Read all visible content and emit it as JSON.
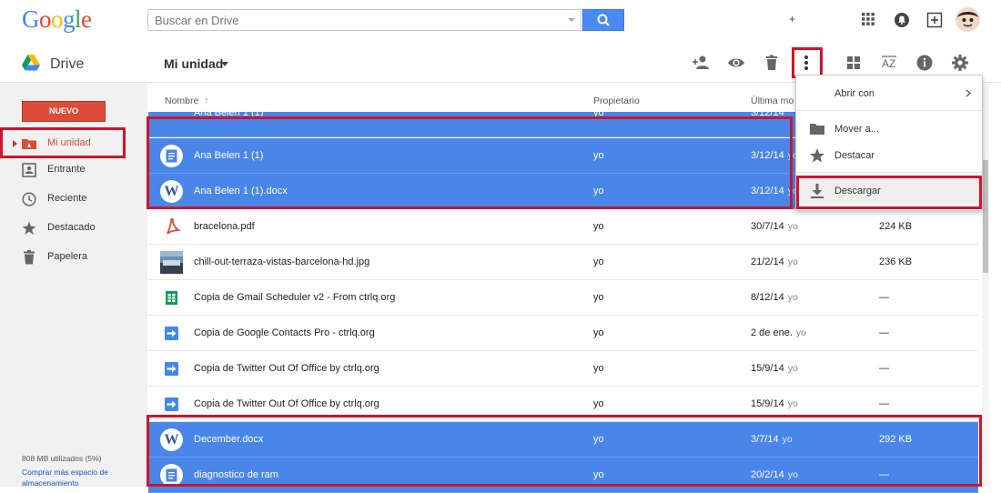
{
  "header": {
    "logo": [
      "G",
      "o",
      "o",
      "g",
      "l",
      "e"
    ],
    "logo_colors": [
      "#4285f4",
      "#ea4335",
      "#fbbc05",
      "#4285f4",
      "#34a853",
      "#ea4335"
    ],
    "search_placeholder": "Buscar en Drive",
    "plus_label": "+"
  },
  "subbar": {
    "app_name": "Drive",
    "folder_title": "Mi unidad"
  },
  "sidebar": {
    "new_label": "NUEVO",
    "items": [
      {
        "label": "Mi unidad",
        "icon": "my-drive-icon",
        "active": true
      },
      {
        "label": "Entrante",
        "icon": "incoming-icon"
      },
      {
        "label": "Reciente",
        "icon": "clock-icon"
      },
      {
        "label": "Destacado",
        "icon": "star-icon"
      },
      {
        "label": "Papelera",
        "icon": "trash-icon"
      }
    ],
    "quota": "808 MB utilizados (5%)",
    "buy_more": "Comprar más espacio de almacenamiento"
  },
  "table": {
    "headers": {
      "name": "Nombre",
      "owner": "Propietario",
      "modified": "Última mo"
    },
    "rows": [
      {
        "name": "Ana Belen 1 (1)",
        "owner": "yo",
        "modified": "3/12/14",
        "by": "yo",
        "size": "",
        "icon": "doc-icon",
        "selected": true
      },
      {
        "name": "Ana Belen 1 (1).docx",
        "owner": "yo",
        "modified": "3/12/14",
        "by": "yo",
        "size": "",
        "icon": "word-icon",
        "selected": true
      },
      {
        "name": "bracelona.pdf",
        "owner": "yo",
        "modified": "30/7/14",
        "by": "yo",
        "size": "224 KB",
        "icon": "pdf-icon",
        "selected": false
      },
      {
        "name": "chill-out-terraza-vistas-barcelona-hd.jpg",
        "owner": "yo",
        "modified": "21/2/14",
        "by": "yo",
        "size": "236 KB",
        "icon": "image-thumbnail",
        "selected": false
      },
      {
        "name": "Copia de Gmail Scheduler v2 - From ctrlq.org",
        "owner": "yo",
        "modified": "8/12/14",
        "by": "yo",
        "size": "—",
        "icon": "sheet-icon",
        "selected": false
      },
      {
        "name": "Copia de Google Contacts Pro - ctrlq.org",
        "owner": "yo",
        "modified": "2 de ene.",
        "by": "yo",
        "size": "—",
        "icon": "shortcut-arrow-icon",
        "selected": false
      },
      {
        "name": "Copia de Twitter Out Of Office by ctrlq.org",
        "owner": "yo",
        "modified": "15/9/14",
        "by": "yo",
        "size": "—",
        "icon": "shortcut-arrow-icon",
        "selected": false
      },
      {
        "name": "Copia de Twitter Out Of Office by ctrlq.org",
        "owner": "yo",
        "modified": "15/9/14",
        "by": "yo",
        "size": "—",
        "icon": "shortcut-arrow-icon",
        "selected": false
      },
      {
        "name": "December.docx",
        "owner": "yo",
        "modified": "3/7/14",
        "by": "yo",
        "size": "292 KB",
        "icon": "word-icon",
        "selected": true
      },
      {
        "name": "diagnostico de ram",
        "owner": "yo",
        "modified": "20/2/14",
        "by": "yo",
        "size": "—",
        "icon": "doc-icon",
        "selected": true
      }
    ]
  },
  "menu": {
    "open_with": "Abrir con",
    "move_to": "Mover a...",
    "star": "Destacar",
    "download": "Descargar"
  },
  "colors": {
    "selection": "#4a86e8",
    "highlight": "#d0142b",
    "new_button": "#dd4b39",
    "search_button": "#4a8af4"
  }
}
